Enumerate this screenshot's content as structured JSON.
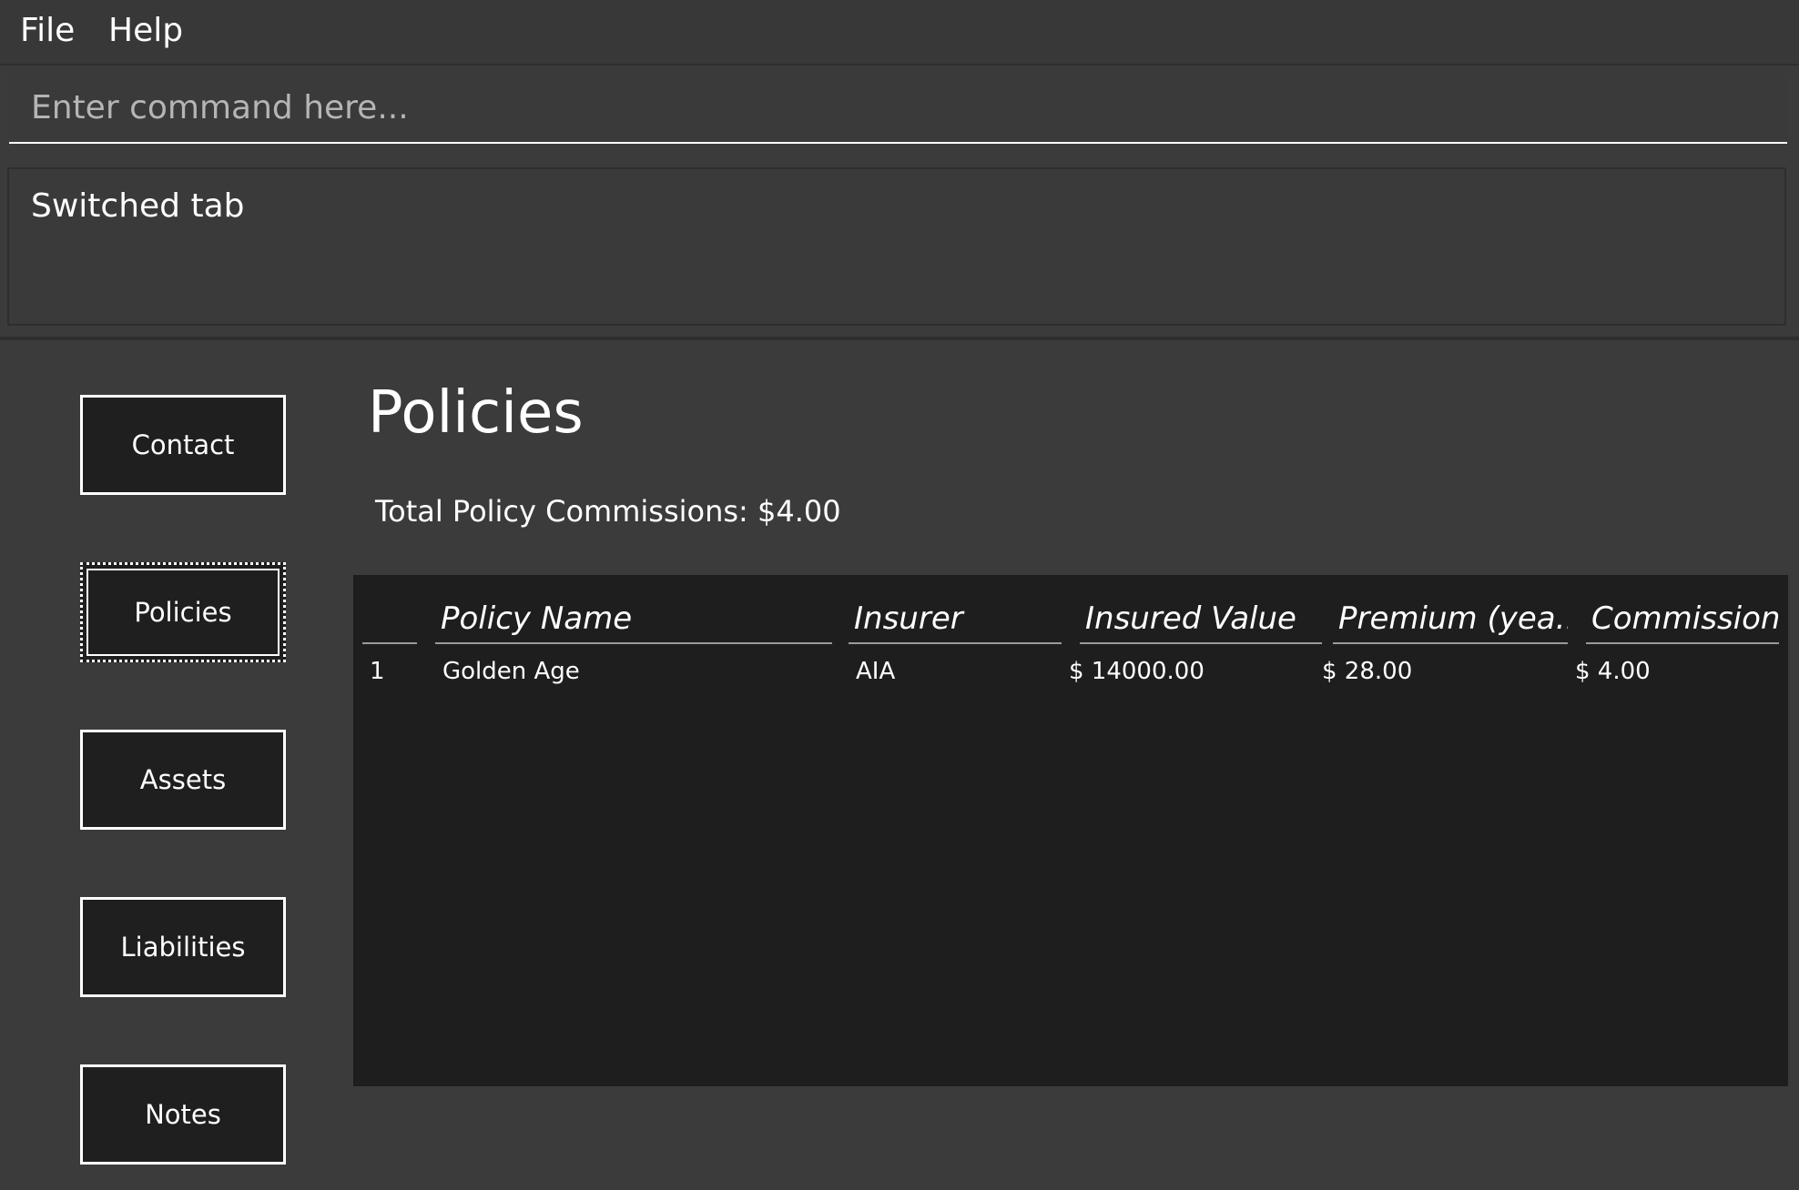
{
  "menubar": {
    "file_label": "File",
    "help_label": "Help"
  },
  "command": {
    "placeholder": "Enter command here...",
    "value": ""
  },
  "result": {
    "text": "Switched tab"
  },
  "sidebar": {
    "items": [
      {
        "label": "Contact",
        "active": false
      },
      {
        "label": "Policies",
        "active": true
      },
      {
        "label": "Assets",
        "active": false
      },
      {
        "label": "Liabilities",
        "active": false
      },
      {
        "label": "Notes",
        "active": false
      }
    ]
  },
  "main": {
    "title": "Policies",
    "total_label": "Total Policy Commissions: $4.00"
  },
  "table": {
    "columns": [
      "",
      "Policy Name",
      "Insurer",
      "Insured Value",
      "Premium (yea...",
      "Commission"
    ],
    "rows": [
      {
        "index": "1",
        "policy_name": "Golden Age",
        "insurer": "AIA",
        "insured_value": "$ 14000.00",
        "premium": "$ 28.00",
        "commission": "$ 4.00"
      }
    ]
  }
}
